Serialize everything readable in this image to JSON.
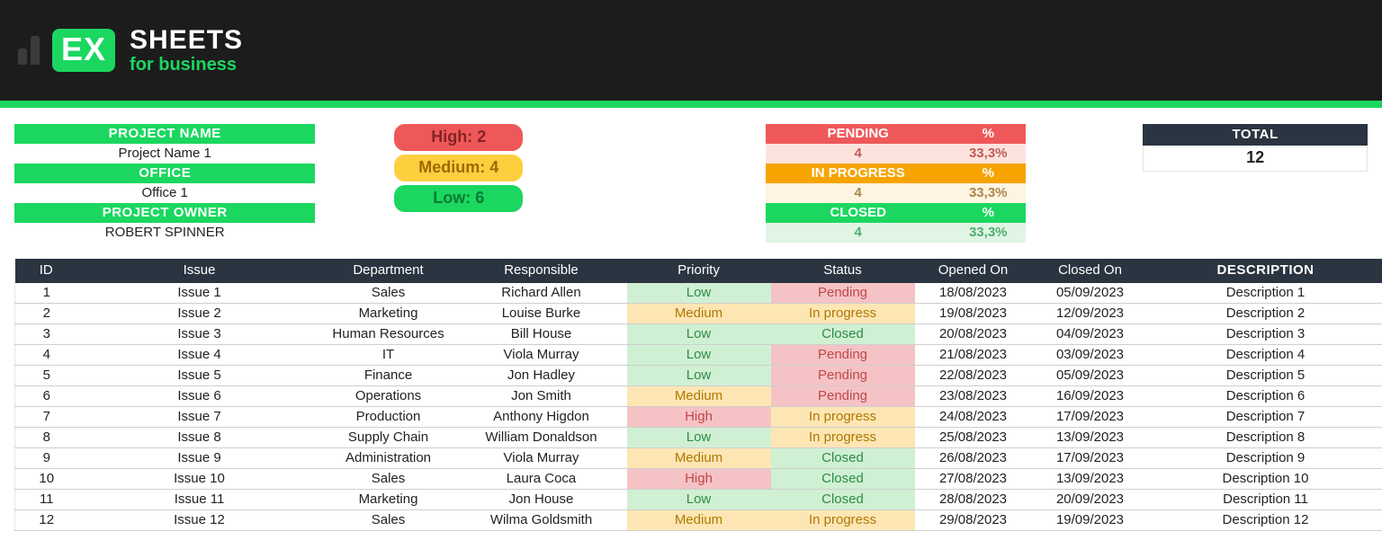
{
  "branding": {
    "mark": "EX",
    "title": "SHEETS",
    "subtitle": "for business"
  },
  "meta": {
    "project_name_label": "PROJECT NAME",
    "project_name_value": "Project Name 1",
    "office_label": "OFFICE",
    "office_value": "Office 1",
    "project_owner_label": "PROJECT OWNER",
    "project_owner_value": "ROBERT SPINNER"
  },
  "priority_summary": {
    "high": {
      "label": "High: 2"
    },
    "medium": {
      "label": "Medium: 4"
    },
    "low": {
      "label": "Low: 6"
    }
  },
  "status_summary": {
    "pending": {
      "label": "PENDING",
      "pct_label": "%",
      "count": "4",
      "pct": "33,3%"
    },
    "in_progress": {
      "label": "IN PROGRESS",
      "pct_label": "%",
      "count": "4",
      "pct": "33,3%"
    },
    "closed": {
      "label": "CLOSED",
      "pct_label": "%",
      "count": "4",
      "pct": "33,3%"
    }
  },
  "total": {
    "label": "TOTAL",
    "value": "12"
  },
  "columns": {
    "id": "ID",
    "issue": "Issue",
    "department": "Department",
    "responsible": "Responsible",
    "priority": "Priority",
    "status": "Status",
    "opened_on": "Opened On",
    "closed_on": "Closed On",
    "description": "DESCRIPTION"
  },
  "rows": [
    {
      "id": "1",
      "issue": "Issue 1",
      "department": "Sales",
      "responsible": "Richard Allen",
      "priority": "Low",
      "status": "Pending",
      "opened_on": "18/08/2023",
      "closed_on": "05/09/2023",
      "description": "Description 1"
    },
    {
      "id": "2",
      "issue": "Issue 2",
      "department": "Marketing",
      "responsible": "Louise Burke",
      "priority": "Medium",
      "status": "In progress",
      "opened_on": "19/08/2023",
      "closed_on": "12/09/2023",
      "description": "Description 2"
    },
    {
      "id": "3",
      "issue": "Issue 3",
      "department": "Human Resources",
      "responsible": "Bill House",
      "priority": "Low",
      "status": "Closed",
      "opened_on": "20/08/2023",
      "closed_on": "04/09/2023",
      "description": "Description 3"
    },
    {
      "id": "4",
      "issue": "Issue 4",
      "department": "IT",
      "responsible": "Viola Murray",
      "priority": "Low",
      "status": "Pending",
      "opened_on": "21/08/2023",
      "closed_on": "03/09/2023",
      "description": "Description 4"
    },
    {
      "id": "5",
      "issue": "Issue 5",
      "department": "Finance",
      "responsible": "Jon Hadley",
      "priority": "Low",
      "status": "Pending",
      "opened_on": "22/08/2023",
      "closed_on": "05/09/2023",
      "description": "Description 5"
    },
    {
      "id": "6",
      "issue": "Issue 6",
      "department": "Operations",
      "responsible": "Jon Smith",
      "priority": "Medium",
      "status": "Pending",
      "opened_on": "23/08/2023",
      "closed_on": "16/09/2023",
      "description": "Description 6"
    },
    {
      "id": "7",
      "issue": "Issue 7",
      "department": "Production",
      "responsible": "Anthony Higdon",
      "priority": "High",
      "status": "In progress",
      "opened_on": "24/08/2023",
      "closed_on": "17/09/2023",
      "description": "Description 7"
    },
    {
      "id": "8",
      "issue": "Issue 8",
      "department": "Supply Chain",
      "responsible": "William Donaldson",
      "priority": "Low",
      "status": "In progress",
      "opened_on": "25/08/2023",
      "closed_on": "13/09/2023",
      "description": "Description 8"
    },
    {
      "id": "9",
      "issue": "Issue 9",
      "department": "Administration",
      "responsible": "Viola Murray",
      "priority": "Medium",
      "status": "Closed",
      "opened_on": "26/08/2023",
      "closed_on": "17/09/2023",
      "description": "Description 9"
    },
    {
      "id": "10",
      "issue": "Issue 10",
      "department": "Sales",
      "responsible": "Laura Coca",
      "priority": "High",
      "status": "Closed",
      "opened_on": "27/08/2023",
      "closed_on": "13/09/2023",
      "description": "Description 10"
    },
    {
      "id": "11",
      "issue": "Issue 11",
      "department": "Marketing",
      "responsible": "Jon House",
      "priority": "Low",
      "status": "Closed",
      "opened_on": "28/08/2023",
      "closed_on": "20/09/2023",
      "description": "Description 11"
    },
    {
      "id": "12",
      "issue": "Issue 12",
      "department": "Sales",
      "responsible": "Wilma Goldsmith",
      "priority": "Medium",
      "status": "In progress",
      "opened_on": "29/08/2023",
      "closed_on": "19/09/2023",
      "description": "Description 12"
    }
  ]
}
